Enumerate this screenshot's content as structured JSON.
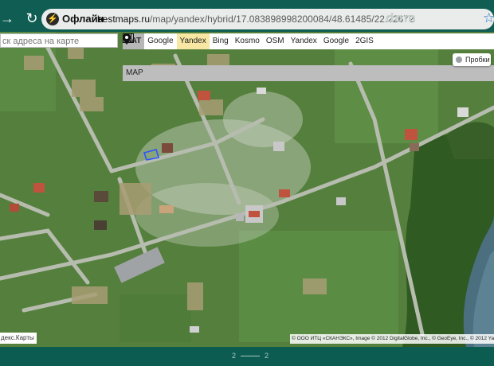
{
  "browser": {
    "back_icon": "arrow-right-icon",
    "reload_icon": "reload-icon",
    "offline_label": "Офлайн",
    "url_host": "bestmaps.ru",
    "url_path": "/map/yandex/hybrid/17.083898998200084/48.61485/22.22672",
    "watermark": "dom",
    "bookmark_icon": "star-icon"
  },
  "map": {
    "search_placeholder": "ск адреса на карте",
    "toolbar": {
      "sat": "SAT",
      "google1": "Google",
      "yandex1": "Yandex",
      "bing": "Bing",
      "kosmo": "Kosmo",
      "map": "MAP",
      "osm": "OSM",
      "yandex2": "Yandex",
      "google2": "Google",
      "2gis": "2GIS"
    },
    "traffic_label": "Пробки",
    "yandex_maps_link": "декс.Карты",
    "copyright": "© ООО ИТЦ «СКАНЭКС», Image © 2012 DigitalGlobe, Inc., © GeoEye, Inc., © 2012 Yandex"
  },
  "pager": {
    "current": "2",
    "total": "2"
  }
}
